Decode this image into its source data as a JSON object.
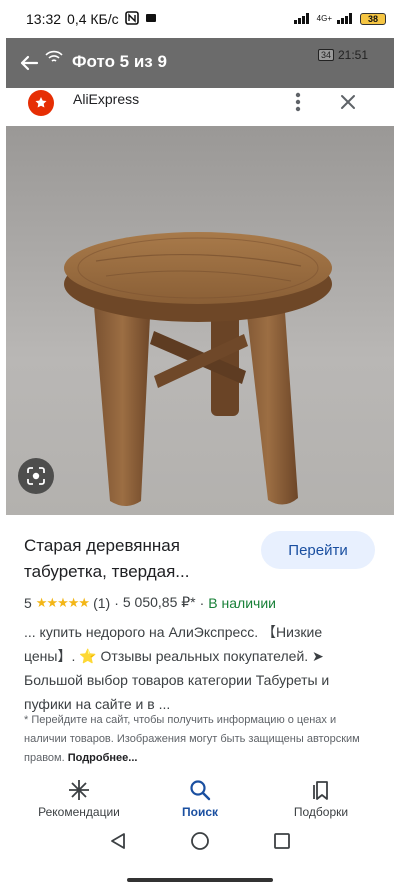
{
  "status_bar": {
    "time": "13:32",
    "network_speed": "0,4 КБ/с",
    "signal_label": "4G+",
    "battery_level": "38"
  },
  "viewer": {
    "title": "Фото 5 из 9",
    "inner_battery": "34",
    "inner_time": "21:51"
  },
  "site": {
    "name": "AliExpress"
  },
  "result": {
    "title": "Старая деревянная табуретка, твердая...",
    "button_label": "Перейти",
    "rating_value": "5",
    "stars": "★★★★★",
    "reviews": "(1)",
    "separator": "·",
    "price": "5 050,85 ₽*",
    "availability": "В наличии",
    "description": "... купить недорого на АлиЭкспресс. 【Низкие цены】. ⭐ Отзывы реальных покупателей. ➤ Большой выбор товаров категории Табуреты и пуфики на сайте и в ...",
    "disclaimer": "* Перейдите на сайт, чтобы получить информацию о ценах и наличии товаров. Изображения могут быть защищены авторским правом.",
    "more_link": "Подробнее..."
  },
  "bottom_nav": {
    "items": [
      {
        "label": "Рекомендации",
        "icon": "asterisk-icon"
      },
      {
        "label": "Поиск",
        "icon": "search-icon"
      },
      {
        "label": "Подборки",
        "icon": "bookmark-icon"
      }
    ]
  },
  "colors": {
    "accent": "#1a4fa0",
    "button_bg": "#e8f0fe",
    "in_stock": "#188038",
    "star": "#f3b617",
    "aliexpress": "#e62e04"
  }
}
